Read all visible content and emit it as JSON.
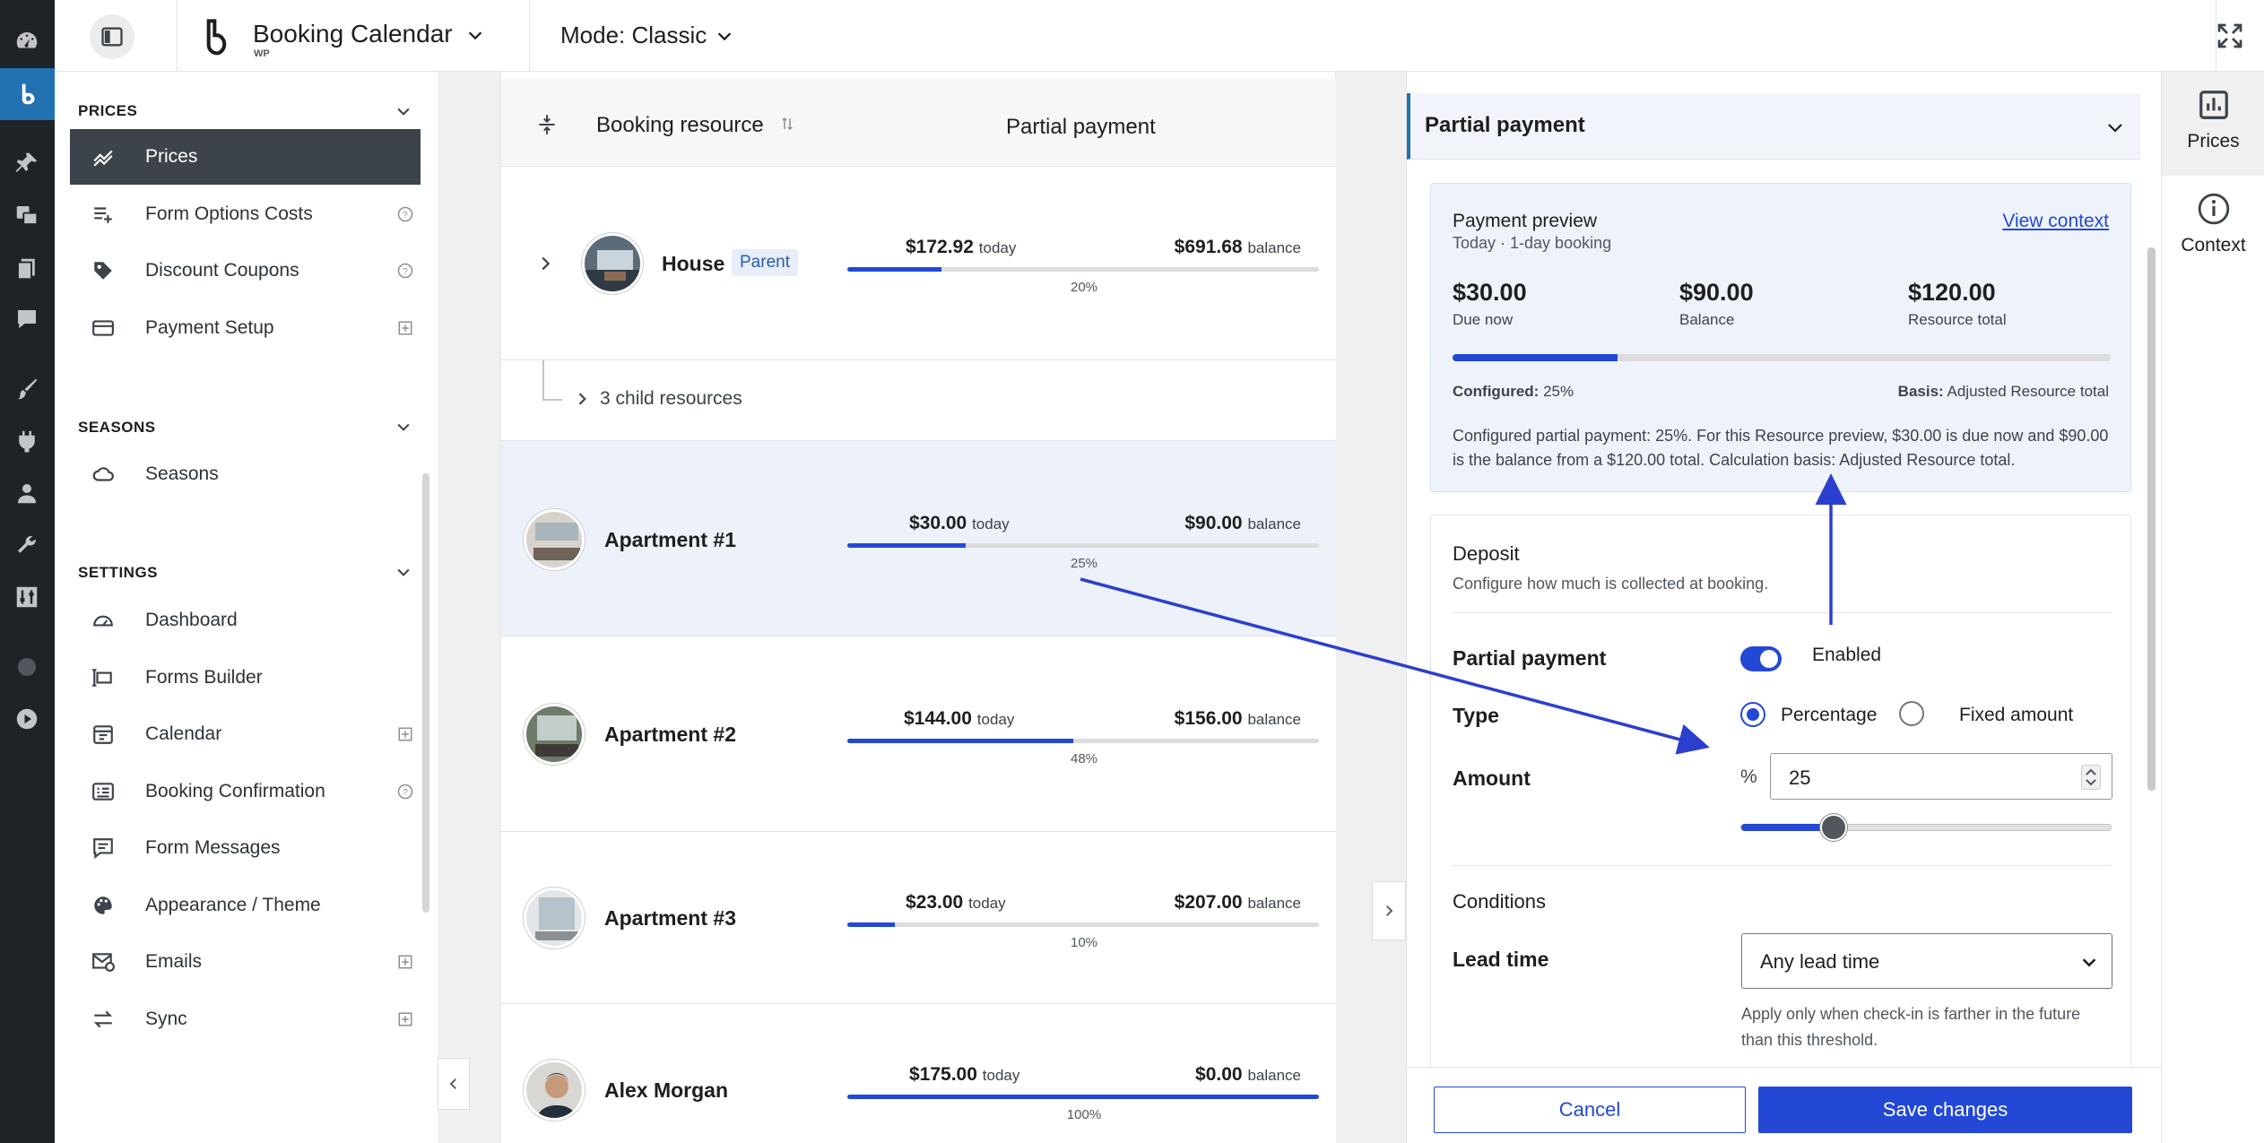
{
  "header": {
    "brand_name": "Booking Calendar",
    "brand_sub": "WP",
    "mode_label": "Mode: Classic"
  },
  "sidebar": {
    "sections": [
      {
        "title": "PRICES",
        "items": [
          {
            "label": "Prices",
            "icon": "trend-icon",
            "selected": true
          },
          {
            "label": "Form Options Costs",
            "icon": "list-add-icon",
            "help": true
          },
          {
            "label": "Discount Coupons",
            "icon": "tag-icon",
            "help": true
          },
          {
            "label": "Payment Setup",
            "icon": "card-icon",
            "plus": true
          }
        ]
      },
      {
        "title": "SEASONS",
        "items": [
          {
            "label": "Seasons",
            "icon": "cloud-icon"
          }
        ]
      },
      {
        "title": "SETTINGS",
        "items": [
          {
            "label": "Dashboard",
            "icon": "gauge-icon"
          },
          {
            "label": "Forms Builder",
            "icon": "form-icon"
          },
          {
            "label": "Calendar",
            "icon": "calendar-icon",
            "plus": true
          },
          {
            "label": "Booking Confirmation",
            "icon": "id-card-icon",
            "help": true
          },
          {
            "label": "Form Messages",
            "icon": "message-icon"
          },
          {
            "label": "Appearance / Theme",
            "icon": "palette-icon"
          },
          {
            "label": "Emails",
            "icon": "email-icon",
            "plus": true
          },
          {
            "label": "Sync",
            "icon": "sync-icon",
            "plus": true
          }
        ]
      }
    ]
  },
  "table": {
    "col_resource": "Booking resource",
    "col_payment": "Partial payment",
    "child_rows_label": "3 child resources",
    "rows": [
      {
        "name": "House",
        "badge": "Parent",
        "today": "$172.92",
        "today_label": "today",
        "balance": "$691.68",
        "balance_label": "balance",
        "percent": "20%",
        "fraction": 0.2
      },
      {
        "name": "Apartment #1",
        "today": "$30.00",
        "today_label": "today",
        "balance": "$90.00",
        "balance_label": "balance",
        "percent": "25%",
        "fraction": 0.25
      },
      {
        "name": "Apartment #2",
        "today": "$144.00",
        "today_label": "today",
        "balance": "$156.00",
        "balance_label": "balance",
        "percent": "48%",
        "fraction": 0.48
      },
      {
        "name": "Apartment #3",
        "today": "$23.00",
        "today_label": "today",
        "balance": "$207.00",
        "balance_label": "balance",
        "percent": "10%",
        "fraction": 0.1
      },
      {
        "name": "Alex Morgan",
        "today": "$175.00",
        "today_label": "today",
        "balance": "$0.00",
        "balance_label": "balance",
        "percent": "100%",
        "fraction": 1.0
      }
    ]
  },
  "panel": {
    "title": "Partial payment",
    "preview": {
      "title": "Payment preview",
      "subtitle": "Today · 1-day booking",
      "link": "View context",
      "due_now": "$30.00",
      "due_now_label": "Due now",
      "balance": "$90.00",
      "balance_label": "Balance",
      "total": "$120.00",
      "total_label": "Resource total",
      "fraction": 0.25,
      "configured_label": "Configured:",
      "configured_value": "25%",
      "basis_label": "Basis:",
      "basis_value": "Adjusted Resource total",
      "description": "Configured partial payment: 25%. For this Resource preview, $30.00 is due now and $90.00 is the balance from a $120.00 total. Calculation basis: Adjusted Resource total."
    },
    "deposit": {
      "title": "Deposit",
      "subtitle": "Configure how much is collected at booking.",
      "partial_label": "Partial payment",
      "toggle_text": "Enabled",
      "type_label": "Type",
      "type_percentage": "Percentage",
      "type_fixed": "Fixed amount",
      "amount_label": "Amount",
      "amount_unit": "%",
      "amount_value": "25",
      "slider_fraction": 0.25,
      "conditions_label": "Conditions",
      "lead_time_label": "Lead time",
      "lead_time_value": "Any lead time",
      "lead_time_help": "Apply only when check-in is farther in the future than this threshold."
    },
    "cancel_label": "Cancel",
    "save_label": "Save changes"
  },
  "rail": {
    "prices_label": "Prices",
    "context_label": "Context"
  },
  "colors": {
    "accent": "#2348d6",
    "wp_admin_bar": "#1d2327",
    "wp_active": "#2271b1",
    "selected_nav": "#3c434a",
    "row_highlight": "#edf2fa"
  }
}
